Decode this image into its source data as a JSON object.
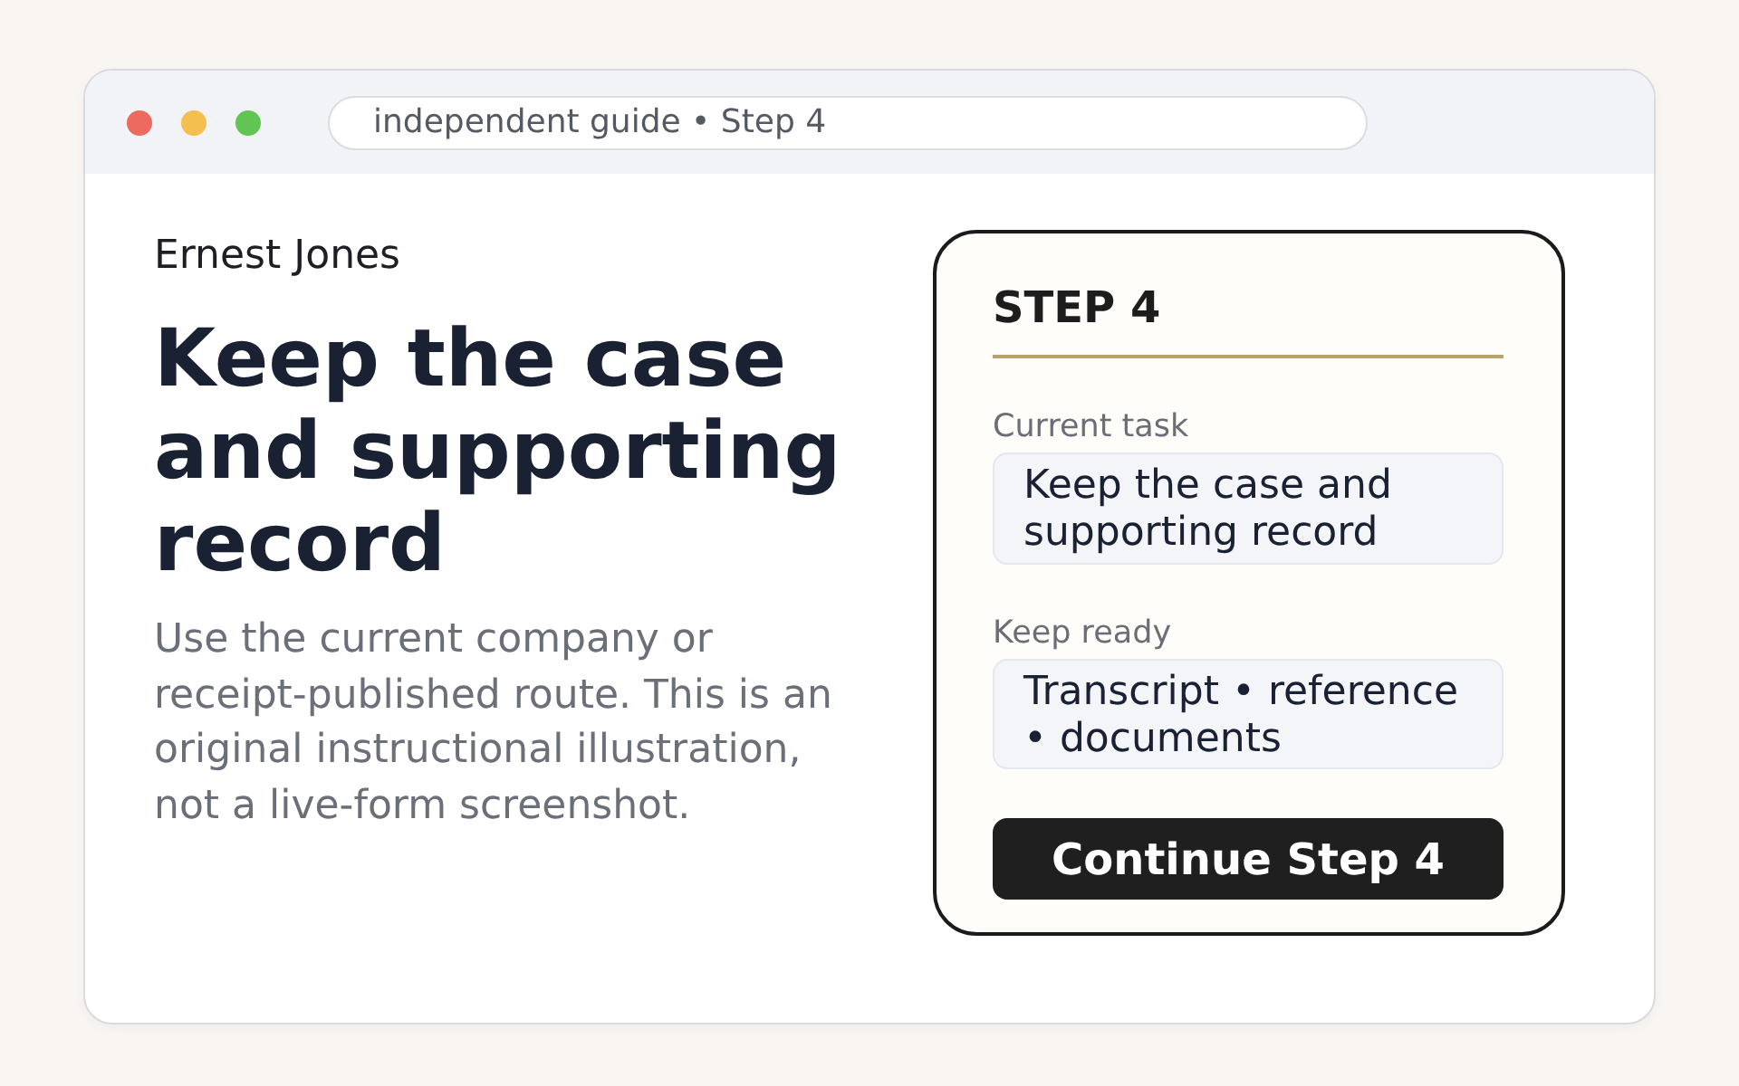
{
  "window": {
    "address": "independent guide • Step 4"
  },
  "author": "Ernest Jones",
  "heading": "Keep the case and supporting record",
  "description": "Use the current company or receipt-published route. This is an original instructional illustration, not a live-form screenshot.",
  "step_card": {
    "title": "STEP 4",
    "fields": [
      {
        "label": "Current task",
        "value": "Keep the case and supporting record"
      },
      {
        "label": "Keep ready",
        "value": "Transcript • reference • documents"
      }
    ],
    "button": "Continue Step 4"
  }
}
